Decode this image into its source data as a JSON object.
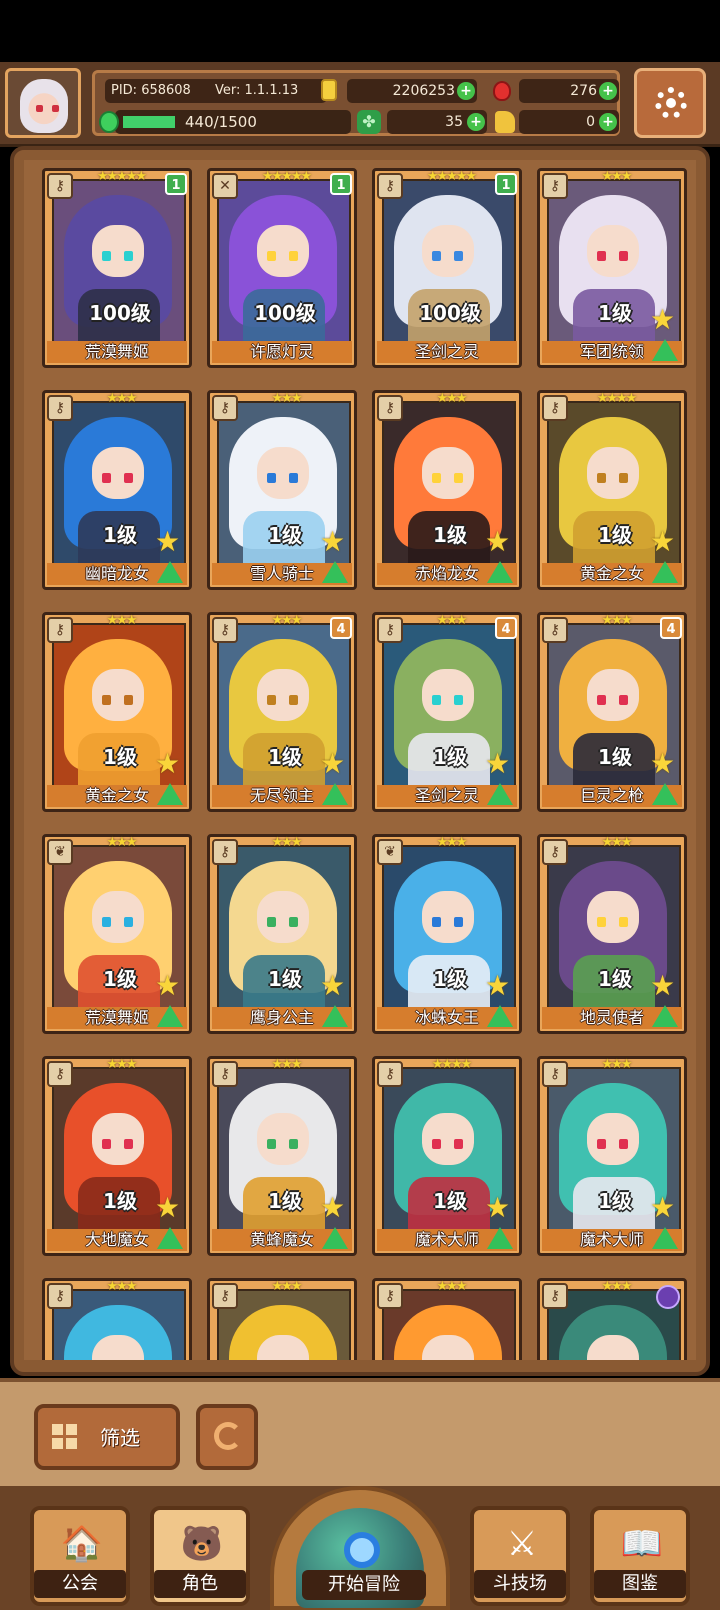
{
  "header": {
    "pid": "PID: 658608",
    "version": "Ver: 1.1.1.13",
    "gold": "2206253",
    "gems": "276",
    "energy": "440/1500",
    "energy_fraction": 0.29,
    "clover": "35",
    "keys": "0"
  },
  "cards": [
    {
      "name": "荒漠舞姬",
      "level": "100级",
      "stars": "★★★★★",
      "rank": "1",
      "rank_color": "green",
      "bg": "#6a4e7c",
      "hair": "#5a4aa0",
      "eye": "#2ad0d0",
      "body": "#2e3048",
      "upgrade": false,
      "class_icon": "⚷"
    },
    {
      "name": "许愿灯灵",
      "level": "100级",
      "stars": "★★★★★",
      "rank": "1",
      "rank_color": "green",
      "bg": "#5c4b9a",
      "hair": "#8a52d8",
      "eye": "#ffd23a",
      "body": "#3b6a9a",
      "upgrade": false,
      "class_icon": "✕"
    },
    {
      "name": "圣剑之灵",
      "level": "100级",
      "stars": "★★★★★",
      "rank": "1",
      "rank_color": "green",
      "bg": "#3a4a6a",
      "hair": "#dfe4f0",
      "eye": "#3a88e0",
      "body": "#c4a26a",
      "upgrade": false,
      "class_icon": "⚷"
    },
    {
      "name": "军团统领",
      "level": "1级",
      "stars": "★★★",
      "rank": "",
      "rank_color": "",
      "bg": "#6a5a7a",
      "hair": "#e8e0f0",
      "eye": "#e03050",
      "body": "#7a5aa0",
      "upgrade": true,
      "class_icon": "⚷"
    },
    {
      "name": "幽暗龙女",
      "level": "1级",
      "stars": "★★★",
      "rank": "",
      "rank_color": "",
      "bg": "#2f4a6a",
      "hair": "#2a7ad8",
      "eye": "#e03050",
      "body": "#2e3a5a",
      "upgrade": true,
      "class_icon": "⚷"
    },
    {
      "name": "雪人骑士",
      "level": "1级",
      "stars": "★★★",
      "rank": "",
      "rank_color": "",
      "bg": "#4a6078",
      "hair": "#eef2f8",
      "eye": "#2a7ad8",
      "body": "#9ad0f0",
      "upgrade": true,
      "class_icon": "⚷"
    },
    {
      "name": "赤焰龙女",
      "level": "1级",
      "stars": "★★★",
      "rank": "",
      "rank_color": "",
      "bg": "#3a2a2a",
      "hair": "#ff7a3a",
      "eye": "#ffd23a",
      "body": "#2a1a1a",
      "upgrade": true,
      "class_icon": "⚷"
    },
    {
      "name": "黄金之女",
      "level": "1级",
      "stars": "★★★★",
      "rank": "",
      "rank_color": "",
      "bg": "#5a4a2a",
      "hair": "#e8c840",
      "eye": "#c08020",
      "body": "#d0a030",
      "upgrade": true,
      "class_icon": "⚷"
    },
    {
      "name": "黄金之女",
      "level": "1级",
      "stars": "★★★",
      "rank": "",
      "rank_color": "",
      "bg": "#b04418",
      "hair": "#ffb040",
      "eye": "#c07020",
      "body": "#f0a030",
      "upgrade": true,
      "class_icon": "⚷"
    },
    {
      "name": "无尽领主",
      "level": "1级",
      "stars": "★★★",
      "rank": "4",
      "rank_color": "orange",
      "bg": "#4a6a8a",
      "hair": "#e8c840",
      "eye": "#c08020",
      "body": "#d0a030",
      "upgrade": true,
      "class_icon": "⚷"
    },
    {
      "name": "圣剑之灵",
      "level": "1级",
      "stars": "★★★",
      "rank": "4",
      "rank_color": "orange",
      "bg": "#2a5a7a",
      "hair": "#8ab060",
      "eye": "#2ad0d0",
      "body": "#e8e8f0",
      "upgrade": true,
      "class_icon": "⚷"
    },
    {
      "name": "巨灵之枪",
      "level": "1级",
      "stars": "★★★",
      "rank": "4",
      "rank_color": "orange",
      "bg": "#5a5a6a",
      "hair": "#f0b040",
      "eye": "#e03050",
      "body": "#2a2a3a",
      "upgrade": true,
      "class_icon": "⚷"
    },
    {
      "name": "荒漠舞姬",
      "level": "1级",
      "stars": "★★★",
      "rank": "",
      "rank_color": "",
      "bg": "#7a4a3a",
      "hair": "#ffd070",
      "eye": "#2ab0e0",
      "body": "#e05030",
      "upgrade": true,
      "class_icon": "❦"
    },
    {
      "name": "鹰身公主",
      "level": "1级",
      "stars": "★★★",
      "rank": "",
      "rank_color": "",
      "bg": "#3a5a6a",
      "hair": "#f4d890",
      "eye": "#3ab060",
      "body": "#3a7a8a",
      "upgrade": true,
      "class_icon": "⚷"
    },
    {
      "name": "冰蛛女王",
      "level": "1级",
      "stars": "★★★",
      "rank": "",
      "rank_color": "",
      "bg": "#2a4a6a",
      "hair": "#4ab0e8",
      "eye": "#2a7ad8",
      "body": "#e8eef6",
      "upgrade": true,
      "class_icon": "❦"
    },
    {
      "name": "地灵使者",
      "level": "1级",
      "stars": "★★★",
      "rank": "",
      "rank_color": "",
      "bg": "#3a3a4a",
      "hair": "#6a4a8a",
      "eye": "#ffd23a",
      "body": "#5aa050",
      "upgrade": true,
      "class_icon": "⚷"
    },
    {
      "name": "大地魔女",
      "level": "1级",
      "stars": "★★★",
      "rank": "",
      "rank_color": "",
      "bg": "#5a3a2a",
      "hair": "#e8502a",
      "eye": "#e03050",
      "body": "#8a2a1a",
      "upgrade": true,
      "class_icon": "⚷"
    },
    {
      "name": "黄蜂魔女",
      "level": "1级",
      "stars": "★★★",
      "rank": "",
      "rank_color": "",
      "bg": "#4a4a5a",
      "hair": "#e8e8ea",
      "eye": "#3ab060",
      "body": "#e0a030",
      "upgrade": true,
      "class_icon": "⚷"
    },
    {
      "name": "魔术大师",
      "level": "1级",
      "stars": "★★★★",
      "rank": "",
      "rank_color": "",
      "bg": "#3a4a5a",
      "hair": "#40b8a8",
      "eye": "#e03050",
      "body": "#c03040",
      "upgrade": true,
      "class_icon": "⚷"
    },
    {
      "name": "魔术大师",
      "level": "1级",
      "stars": "★★★",
      "rank": "",
      "rank_color": "",
      "bg": "#4a5a6a",
      "hair": "#40c0b0",
      "eye": "#e03050",
      "body": "#e8e8f0",
      "upgrade": true,
      "class_icon": "⚷"
    },
    {
      "name": "",
      "level": "",
      "stars": "★★★",
      "rank": "",
      "rank_color": "",
      "bg": "#3a5a7a",
      "hair": "#40b8e0",
      "eye": "#2a7ad8",
      "body": "#3a8ac0",
      "upgrade": false,
      "class_icon": "⚷"
    },
    {
      "name": "",
      "level": "",
      "stars": "★★★",
      "rank": "",
      "rank_color": "",
      "bg": "#6a5a3a",
      "hair": "#f0c030",
      "eye": "#c08020",
      "body": "#d0a030",
      "upgrade": false,
      "class_icon": "⚷"
    },
    {
      "name": "",
      "level": "",
      "stars": "★★★",
      "rank": "",
      "rank_color": "",
      "bg": "#6a3a2a",
      "hair": "#ff9a30",
      "eye": "#e03050",
      "body": "#e05030",
      "upgrade": false,
      "class_icon": "⚷"
    },
    {
      "name": "",
      "level": "",
      "stars": "★★★",
      "rank": "",
      "rank_color": "",
      "bg": "#2a4a4a",
      "hair": "#3a8a7a",
      "eye": "#e03050",
      "body": "#2a5a5a",
      "upgrade": false,
      "class_icon": "⚷",
      "orb": true
    }
  ],
  "filter": {
    "label": "筛选"
  },
  "nav": {
    "guild": "公会",
    "character": "角色",
    "adventure": "开始冒险",
    "arena": "斗技场",
    "codex": "图鉴"
  }
}
